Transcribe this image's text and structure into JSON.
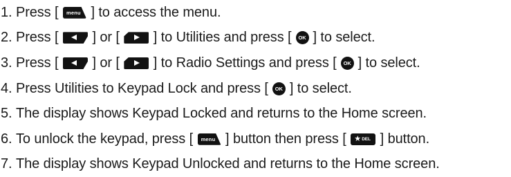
{
  "keys": {
    "menu": {
      "label": "menu",
      "icon": "menu-key-icon"
    },
    "left": {
      "icon": "left-arrow-key-icon"
    },
    "right": {
      "icon": "right-arrow-key-icon"
    },
    "ok": {
      "label": "OK",
      "icon": "ok-key-icon"
    },
    "star_del": {
      "star": "★",
      "label": "DEL",
      "icon": "star-del-key-icon"
    }
  },
  "steps": [
    {
      "number": "1.",
      "parts": [
        "Press [",
        "] to access the menu."
      ]
    },
    {
      "number": "2.",
      "parts": [
        "Press [",
        "] or [",
        "] to Utilities and press [",
        "] to select."
      ]
    },
    {
      "number": "3.",
      "parts": [
        "Press [",
        "] or [",
        "] to Radio Settings and press [",
        "] to select."
      ]
    },
    {
      "number": "4.",
      "parts": [
        "Press Utilities to Keypad Lock and press [",
        "] to select."
      ]
    },
    {
      "number": "5.",
      "parts": [
        "The display shows Keypad Locked and returns to the Home screen."
      ]
    },
    {
      "number": "6.",
      "parts": [
        "To unlock the keypad, press [",
        "] button then press [",
        "] button."
      ]
    },
    {
      "number": "7.",
      "parts": [
        "The display shows Keypad Unlocked and returns to the Home screen."
      ]
    }
  ]
}
